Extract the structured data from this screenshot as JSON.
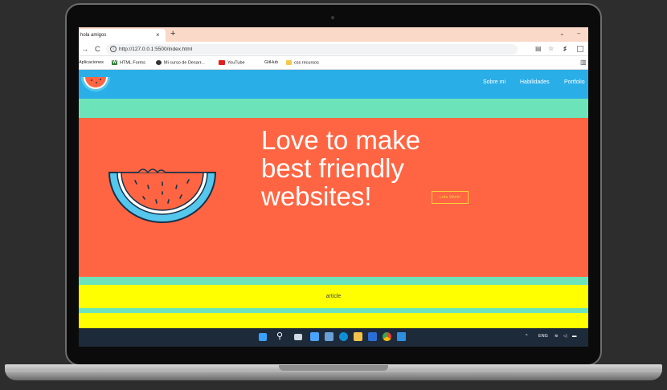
{
  "browser": {
    "tab_title": "hola amigos",
    "tab_close": "×",
    "new_tab": "+",
    "minimize": "–",
    "chevron": "⌄",
    "back": "→",
    "reload": "C",
    "url": "http://127.0.0.1:5500/index.html",
    "bookmarks": [
      "Aplicaciones",
      "HTML Forms",
      "Mi curso de Desarr...",
      "YouTube",
      "GitHub",
      "css recursos"
    ]
  },
  "site": {
    "nav": [
      "Sobre mi",
      "Habilidades",
      "Portfolio"
    ],
    "hero_title": "Love to make best friendly websites!",
    "cta_label": "Lets Work!",
    "article_label": "article"
  },
  "taskbar": {
    "lang": "ENG"
  },
  "colors": {
    "header": "#2aaee8",
    "green": "#6de3b9",
    "hero": "#ff6543",
    "yellow": "#ffff00",
    "taskbar": "#1d2a3a"
  }
}
